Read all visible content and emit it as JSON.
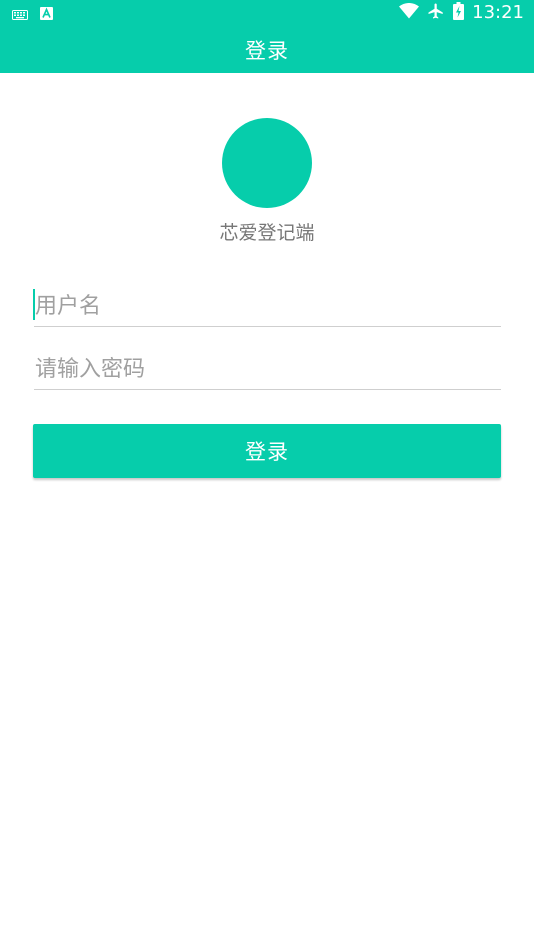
{
  "status_bar": {
    "time": "13:21",
    "icons": [
      "keyboard-icon",
      "a-letter-icon",
      "wifi-icon",
      "airplane-icon",
      "battery-icon"
    ]
  },
  "toolbar": {
    "title": "登录"
  },
  "app": {
    "name": "芯爱登记端"
  },
  "form": {
    "username_placeholder": "用户名",
    "password_placeholder": "请输入密码",
    "login_label": "登录"
  },
  "colors": {
    "accent": "#06cdab",
    "text_gray": "#777777",
    "placeholder_gray": "#a0a0a0",
    "divider": "#cfcfcf"
  }
}
